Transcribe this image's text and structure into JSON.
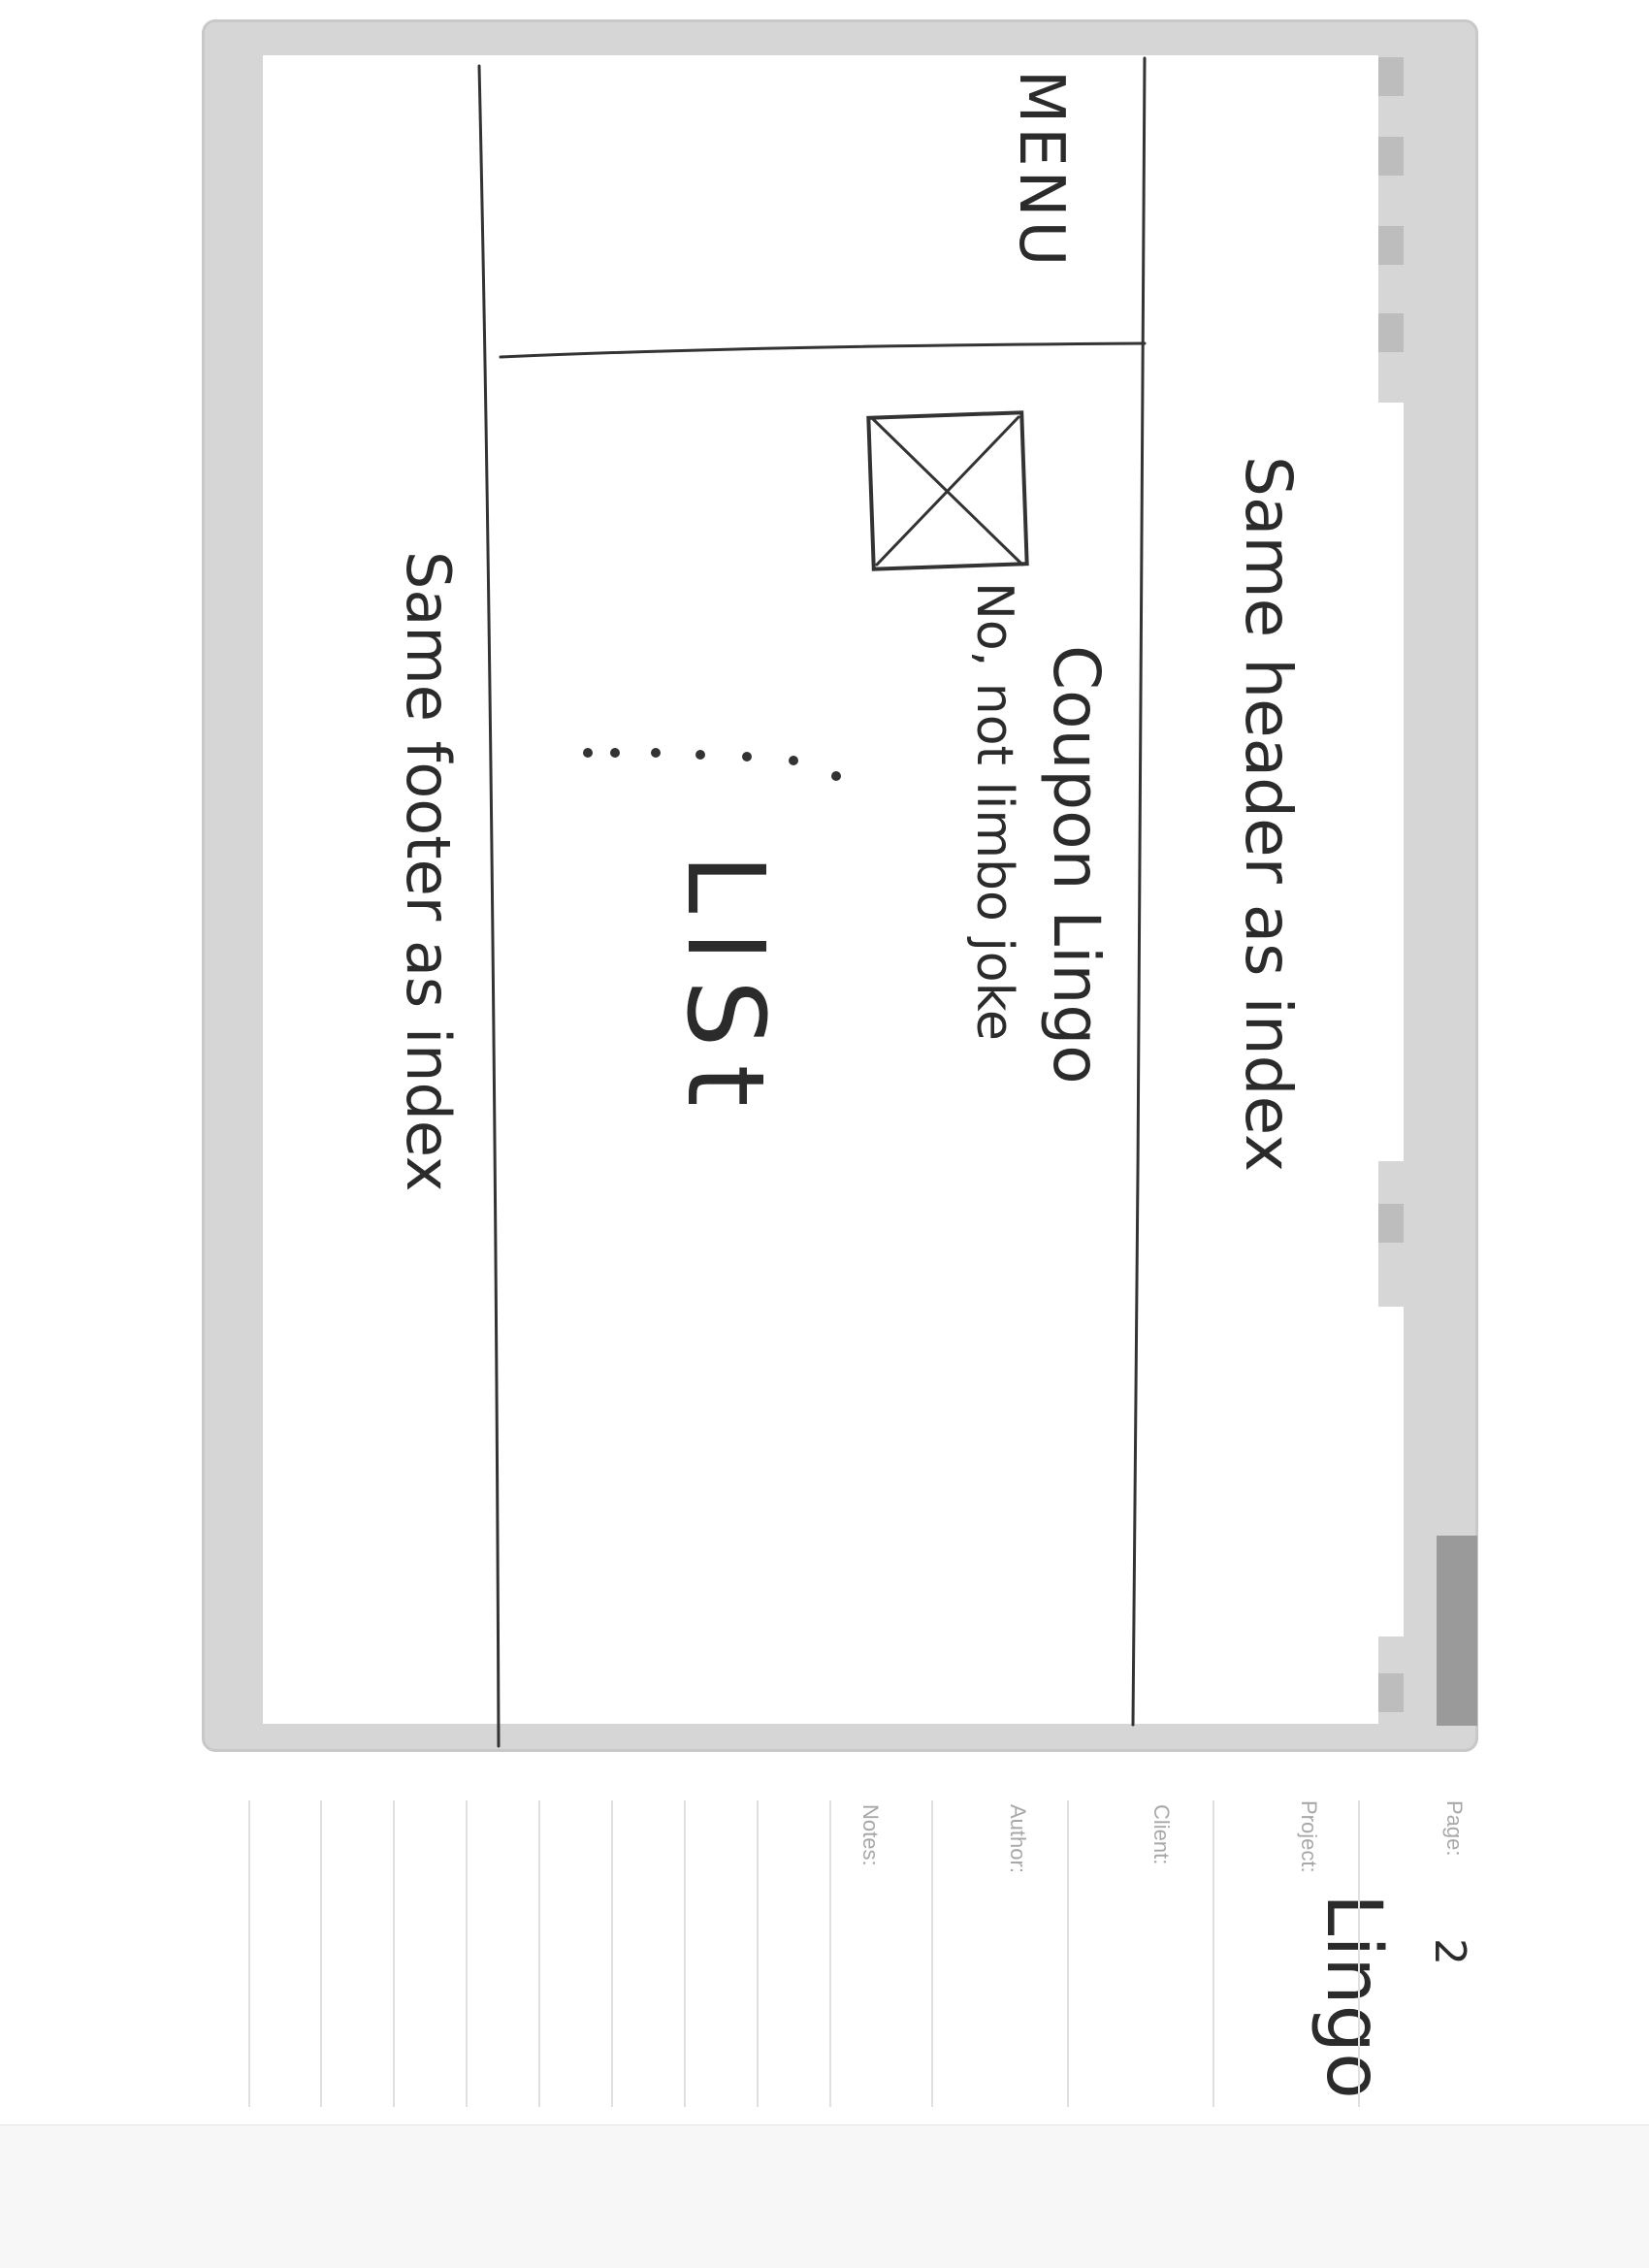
{
  "sketch": {
    "menu_label": "MENU",
    "header_label": "Same header as index",
    "title_label": "Coupon Lingo",
    "subtitle_label": "No, not limbo joke",
    "dots_label": ". . . . . . .",
    "list_label": "LISt",
    "footer_label": "Same footer as index"
  },
  "meta": {
    "page_label": "Page:",
    "page_value": "2",
    "project_label": "Project:",
    "project_value": "Lingo",
    "client_label": "Client:",
    "author_label": "Author:",
    "notes_label": "Notes:"
  }
}
